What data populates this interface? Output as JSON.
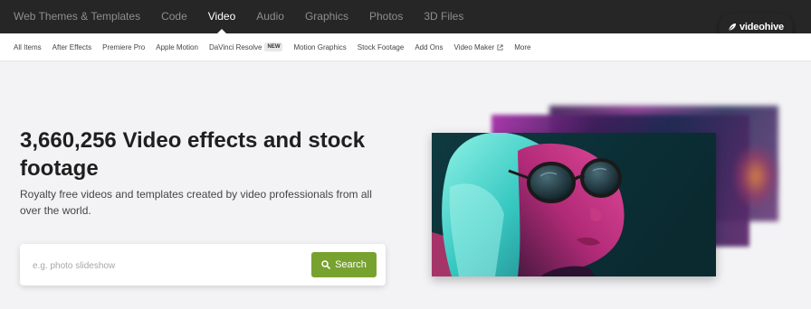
{
  "topnav": {
    "tabs": [
      {
        "label": "Web Themes & Templates",
        "active": false
      },
      {
        "label": "Code",
        "active": false
      },
      {
        "label": "Video",
        "active": true
      },
      {
        "label": "Audio",
        "active": false
      },
      {
        "label": "Graphics",
        "active": false
      },
      {
        "label": "Photos",
        "active": false
      },
      {
        "label": "3D Files",
        "active": false
      }
    ],
    "logo": {
      "text": "videohive",
      "icon": "leaf-icon"
    }
  },
  "subnav": {
    "items": [
      {
        "label": "All Items"
      },
      {
        "label": "After Effects"
      },
      {
        "label": "Premiere Pro"
      },
      {
        "label": "Apple Motion"
      },
      {
        "label": "DaVinci Resolve",
        "badge": "NEW"
      },
      {
        "label": "Motion Graphics"
      },
      {
        "label": "Stock Footage"
      },
      {
        "label": "Add Ons"
      },
      {
        "label": "Video Maker",
        "icon": "external-link-icon"
      },
      {
        "label": "More"
      }
    ]
  },
  "hero": {
    "headline": "3,660,256 Video effects and stock footage",
    "subheadline": "Royalty free videos and templates created by video professionals from all over the world.",
    "search": {
      "placeholder": "e.g. photo slideshow",
      "value": "",
      "button_label": "Search",
      "button_icon": "search-icon"
    }
  },
  "colors": {
    "topnav_bg": "#262626",
    "accent_green": "#78a22f",
    "page_bg": "#f3f3f5"
  }
}
